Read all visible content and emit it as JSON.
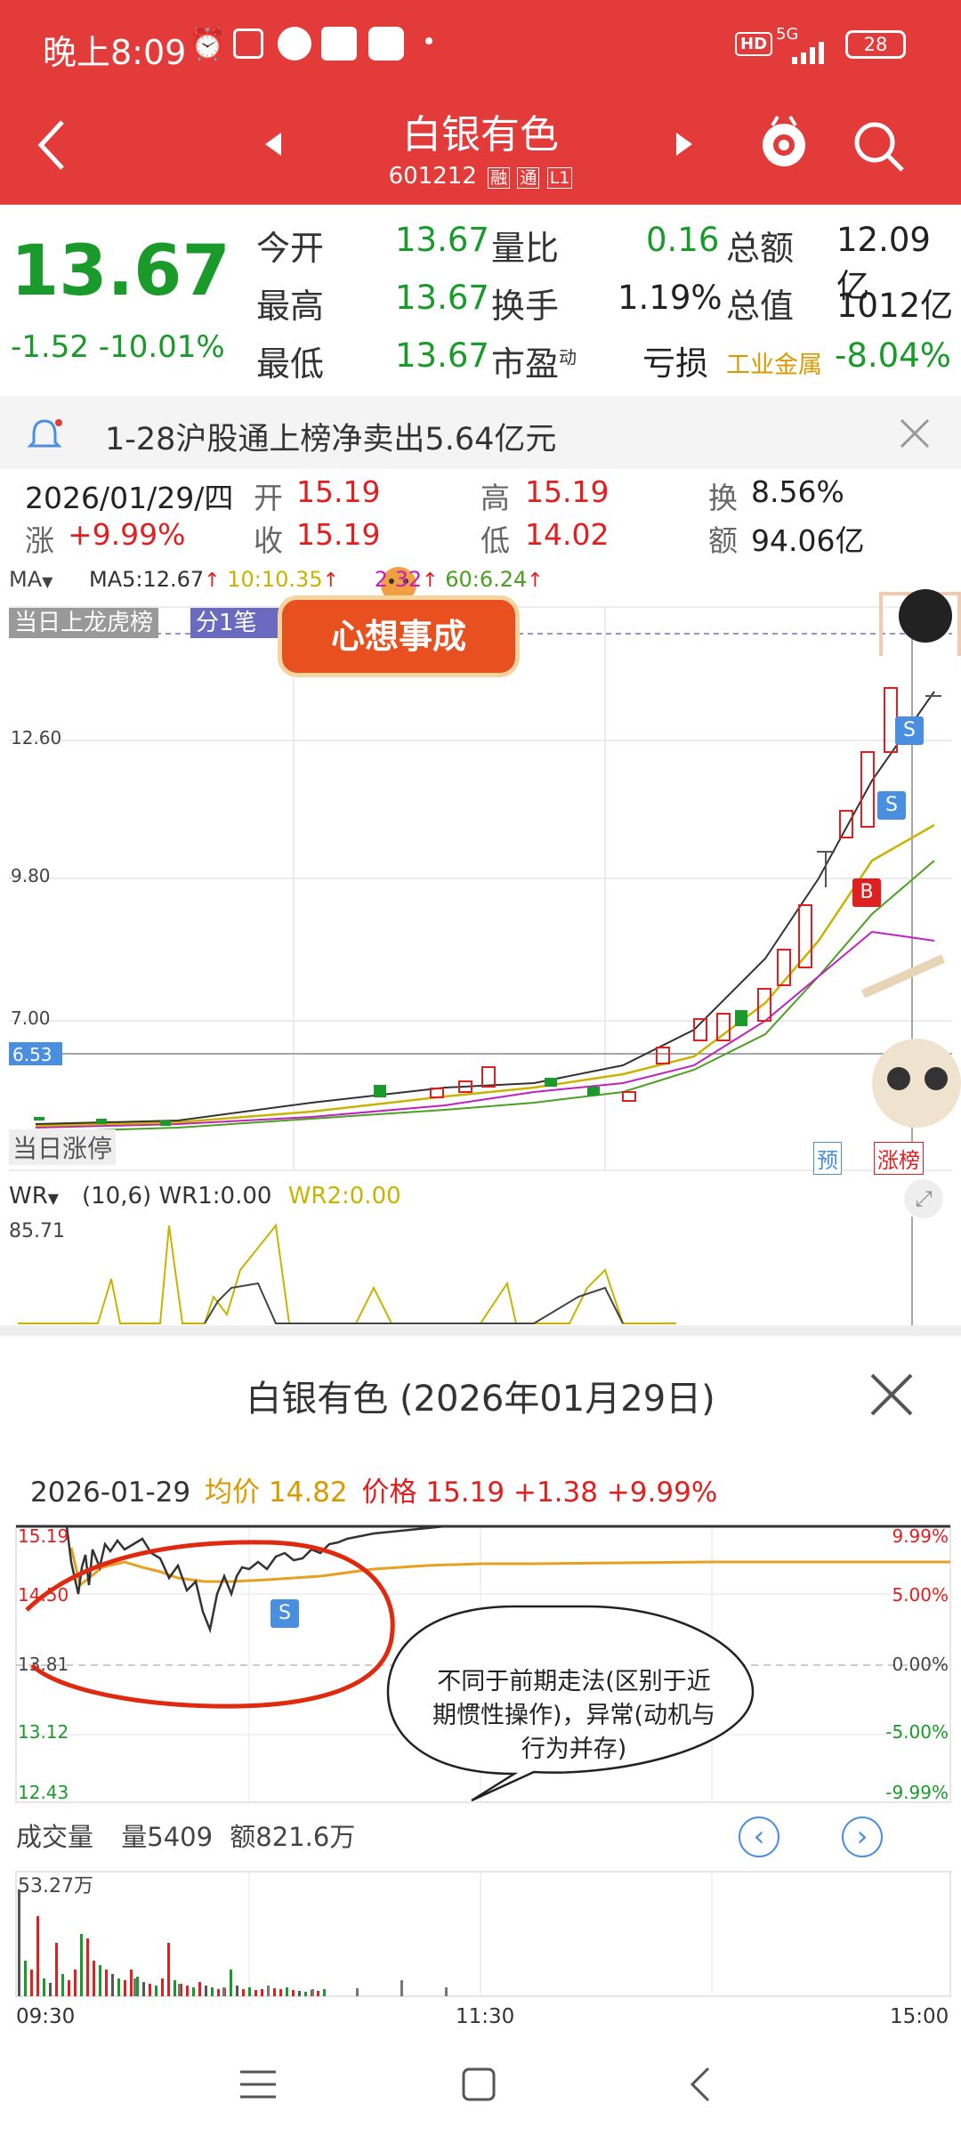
{
  "status": {
    "time": "晚上8:09",
    "network": "5G",
    "battery": "28",
    "hd": "HD"
  },
  "header": {
    "title": "白银有色",
    "code": "601212",
    "tag1": "融",
    "tag2": "通",
    "tag3": "L1"
  },
  "quote": {
    "price": "13.67",
    "change": "-1.52",
    "change_pct": "-10.01%",
    "rows": [
      {
        "l1": "今开",
        "v1": "13.67",
        "l2": "量比",
        "v2": "0.16",
        "l3": "总额",
        "v3": "12.09亿"
      },
      {
        "l1": "最高",
        "v1": "13.67",
        "l2": "换手",
        "v2": "1.19%",
        "l3": "总值",
        "v3": "1012亿"
      },
      {
        "l1": "最低",
        "v1": "13.67",
        "l2": "市盈",
        "l2sup": "动",
        "v2": "亏损",
        "l3": "工业金属",
        "v3": "-8.04%"
      }
    ]
  },
  "notice": {
    "text": "1-28沪股通上榜净卖出5.64亿元"
  },
  "day_info": {
    "date": "2026/01/29/四",
    "open_label": "开",
    "open": "15.19",
    "high_label": "高",
    "high": "15.19",
    "turnover_label": "换",
    "turnover": "8.56%",
    "change_label": "涨",
    "change": "+9.99%",
    "close_label": "收",
    "close": "15.19",
    "low_label": "低",
    "low": "14.02",
    "amount_label": "额",
    "amount": "94.06亿"
  },
  "ma_bar": {
    "label": "MA",
    "ma5": "MA5:12.67",
    "ma10": "10:10.35",
    "ma20": "2",
    "ma20b": "32",
    "ma60": "60:6.24"
  },
  "kline": {
    "banner_left": "当日上龙虎榜",
    "banner_mid": "分1笔",
    "sticker": "心想事成",
    "bottom_label": "当日涨停",
    "tag_pre": "预",
    "tag_zt": "涨榜",
    "markers": {
      "b": "B",
      "s1": "S",
      "s2": "S"
    }
  },
  "wr": {
    "label": "WR",
    "params": "(10,6)",
    "wr1": "WR1:0.00",
    "wr2": "WR2:0.00",
    "max": "85.71"
  },
  "intraday": {
    "title": "白银有色 (2026年01月29日)",
    "date": "2026-01-29",
    "avg_label": "均价",
    "avg": "14.82",
    "price_label": "价格",
    "price": "15.19",
    "chg": "+1.38",
    "pct": "+9.99%",
    "marker": "S",
    "annotation": "不同于前期走法(区别于近期惯性操作)，异常(动机与行为并存)",
    "volume_label": "成交量",
    "vol_label": "量",
    "vol": "5409",
    "amt_label": "额",
    "amt": "821.6万",
    "vol_max": "53.27万",
    "time_start": "09:30",
    "time_mid": "11:30",
    "time_end": "15:00"
  },
  "colors": {
    "brand": "#e33a3a",
    "up": "#e02020",
    "down": "#1a9a2a",
    "ma5": "#333333",
    "ma10": "#c8b400",
    "ma20": "#c020c0",
    "ma60": "#4aa020"
  },
  "chart_data": [
    {
      "type": "candlestick",
      "title": "",
      "y_ticks": [
        "12.60",
        "9.80",
        "7.00",
        "6.53"
      ],
      "series": [
        {
          "name": "MA5",
          "values": [
            12.67
          ]
        },
        {
          "name": "10",
          "values": [
            10.35
          ]
        },
        {
          "name": "60",
          "values": [
            6.24
          ]
        }
      ]
    },
    {
      "type": "line",
      "title": "",
      "y_left": [
        "15.19",
        "14.50",
        "13.81",
        "13.12",
        "12.43"
      ],
      "y_right": [
        "9.99%",
        "5.00%",
        "0.00%",
        "-5.00%",
        "-9.99%"
      ],
      "x": [
        "09:30",
        "11:30",
        "15:00"
      ]
    }
  ]
}
